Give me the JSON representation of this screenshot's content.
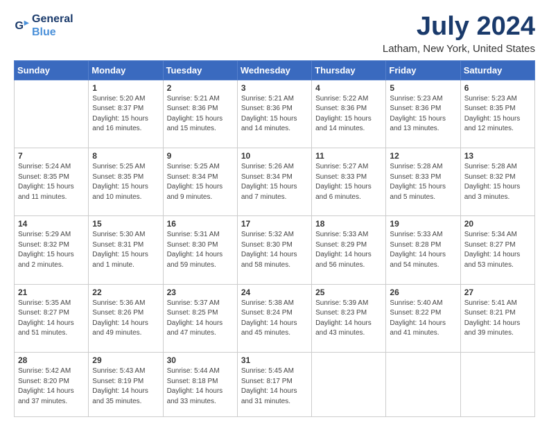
{
  "logo": {
    "text_general": "General",
    "text_blue": "Blue"
  },
  "header": {
    "month": "July 2024",
    "location": "Latham, New York, United States"
  },
  "weekdays": [
    "Sunday",
    "Monday",
    "Tuesday",
    "Wednesday",
    "Thursday",
    "Friday",
    "Saturday"
  ],
  "weeks": [
    [
      null,
      {
        "day": "1",
        "sunrise": "5:20 AM",
        "sunset": "8:37 PM",
        "daylight": "15 hours and 16 minutes."
      },
      {
        "day": "2",
        "sunrise": "5:21 AM",
        "sunset": "8:36 PM",
        "daylight": "15 hours and 15 minutes."
      },
      {
        "day": "3",
        "sunrise": "5:21 AM",
        "sunset": "8:36 PM",
        "daylight": "15 hours and 14 minutes."
      },
      {
        "day": "4",
        "sunrise": "5:22 AM",
        "sunset": "8:36 PM",
        "daylight": "15 hours and 14 minutes."
      },
      {
        "day": "5",
        "sunrise": "5:23 AM",
        "sunset": "8:36 PM",
        "daylight": "15 hours and 13 minutes."
      },
      {
        "day": "6",
        "sunrise": "5:23 AM",
        "sunset": "8:35 PM",
        "daylight": "15 hours and 12 minutes."
      }
    ],
    [
      {
        "day": "7",
        "sunrise": "5:24 AM",
        "sunset": "8:35 PM",
        "daylight": "15 hours and 11 minutes."
      },
      {
        "day": "8",
        "sunrise": "5:25 AM",
        "sunset": "8:35 PM",
        "daylight": "15 hours and 10 minutes."
      },
      {
        "day": "9",
        "sunrise": "5:25 AM",
        "sunset": "8:34 PM",
        "daylight": "15 hours and 9 minutes."
      },
      {
        "day": "10",
        "sunrise": "5:26 AM",
        "sunset": "8:34 PM",
        "daylight": "15 hours and 7 minutes."
      },
      {
        "day": "11",
        "sunrise": "5:27 AM",
        "sunset": "8:33 PM",
        "daylight": "15 hours and 6 minutes."
      },
      {
        "day": "12",
        "sunrise": "5:28 AM",
        "sunset": "8:33 PM",
        "daylight": "15 hours and 5 minutes."
      },
      {
        "day": "13",
        "sunrise": "5:28 AM",
        "sunset": "8:32 PM",
        "daylight": "15 hours and 3 minutes."
      }
    ],
    [
      {
        "day": "14",
        "sunrise": "5:29 AM",
        "sunset": "8:32 PM",
        "daylight": "15 hours and 2 minutes."
      },
      {
        "day": "15",
        "sunrise": "5:30 AM",
        "sunset": "8:31 PM",
        "daylight": "15 hours and 1 minute."
      },
      {
        "day": "16",
        "sunrise": "5:31 AM",
        "sunset": "8:30 PM",
        "daylight": "14 hours and 59 minutes."
      },
      {
        "day": "17",
        "sunrise": "5:32 AM",
        "sunset": "8:30 PM",
        "daylight": "14 hours and 58 minutes."
      },
      {
        "day": "18",
        "sunrise": "5:33 AM",
        "sunset": "8:29 PM",
        "daylight": "14 hours and 56 minutes."
      },
      {
        "day": "19",
        "sunrise": "5:33 AM",
        "sunset": "8:28 PM",
        "daylight": "14 hours and 54 minutes."
      },
      {
        "day": "20",
        "sunrise": "5:34 AM",
        "sunset": "8:27 PM",
        "daylight": "14 hours and 53 minutes."
      }
    ],
    [
      {
        "day": "21",
        "sunrise": "5:35 AM",
        "sunset": "8:27 PM",
        "daylight": "14 hours and 51 minutes."
      },
      {
        "day": "22",
        "sunrise": "5:36 AM",
        "sunset": "8:26 PM",
        "daylight": "14 hours and 49 minutes."
      },
      {
        "day": "23",
        "sunrise": "5:37 AM",
        "sunset": "8:25 PM",
        "daylight": "14 hours and 47 minutes."
      },
      {
        "day": "24",
        "sunrise": "5:38 AM",
        "sunset": "8:24 PM",
        "daylight": "14 hours and 45 minutes."
      },
      {
        "day": "25",
        "sunrise": "5:39 AM",
        "sunset": "8:23 PM",
        "daylight": "14 hours and 43 minutes."
      },
      {
        "day": "26",
        "sunrise": "5:40 AM",
        "sunset": "8:22 PM",
        "daylight": "14 hours and 41 minutes."
      },
      {
        "day": "27",
        "sunrise": "5:41 AM",
        "sunset": "8:21 PM",
        "daylight": "14 hours and 39 minutes."
      }
    ],
    [
      {
        "day": "28",
        "sunrise": "5:42 AM",
        "sunset": "8:20 PM",
        "daylight": "14 hours and 37 minutes."
      },
      {
        "day": "29",
        "sunrise": "5:43 AM",
        "sunset": "8:19 PM",
        "daylight": "14 hours and 35 minutes."
      },
      {
        "day": "30",
        "sunrise": "5:44 AM",
        "sunset": "8:18 PM",
        "daylight": "14 hours and 33 minutes."
      },
      {
        "day": "31",
        "sunrise": "5:45 AM",
        "sunset": "8:17 PM",
        "daylight": "14 hours and 31 minutes."
      },
      null,
      null,
      null
    ]
  ]
}
